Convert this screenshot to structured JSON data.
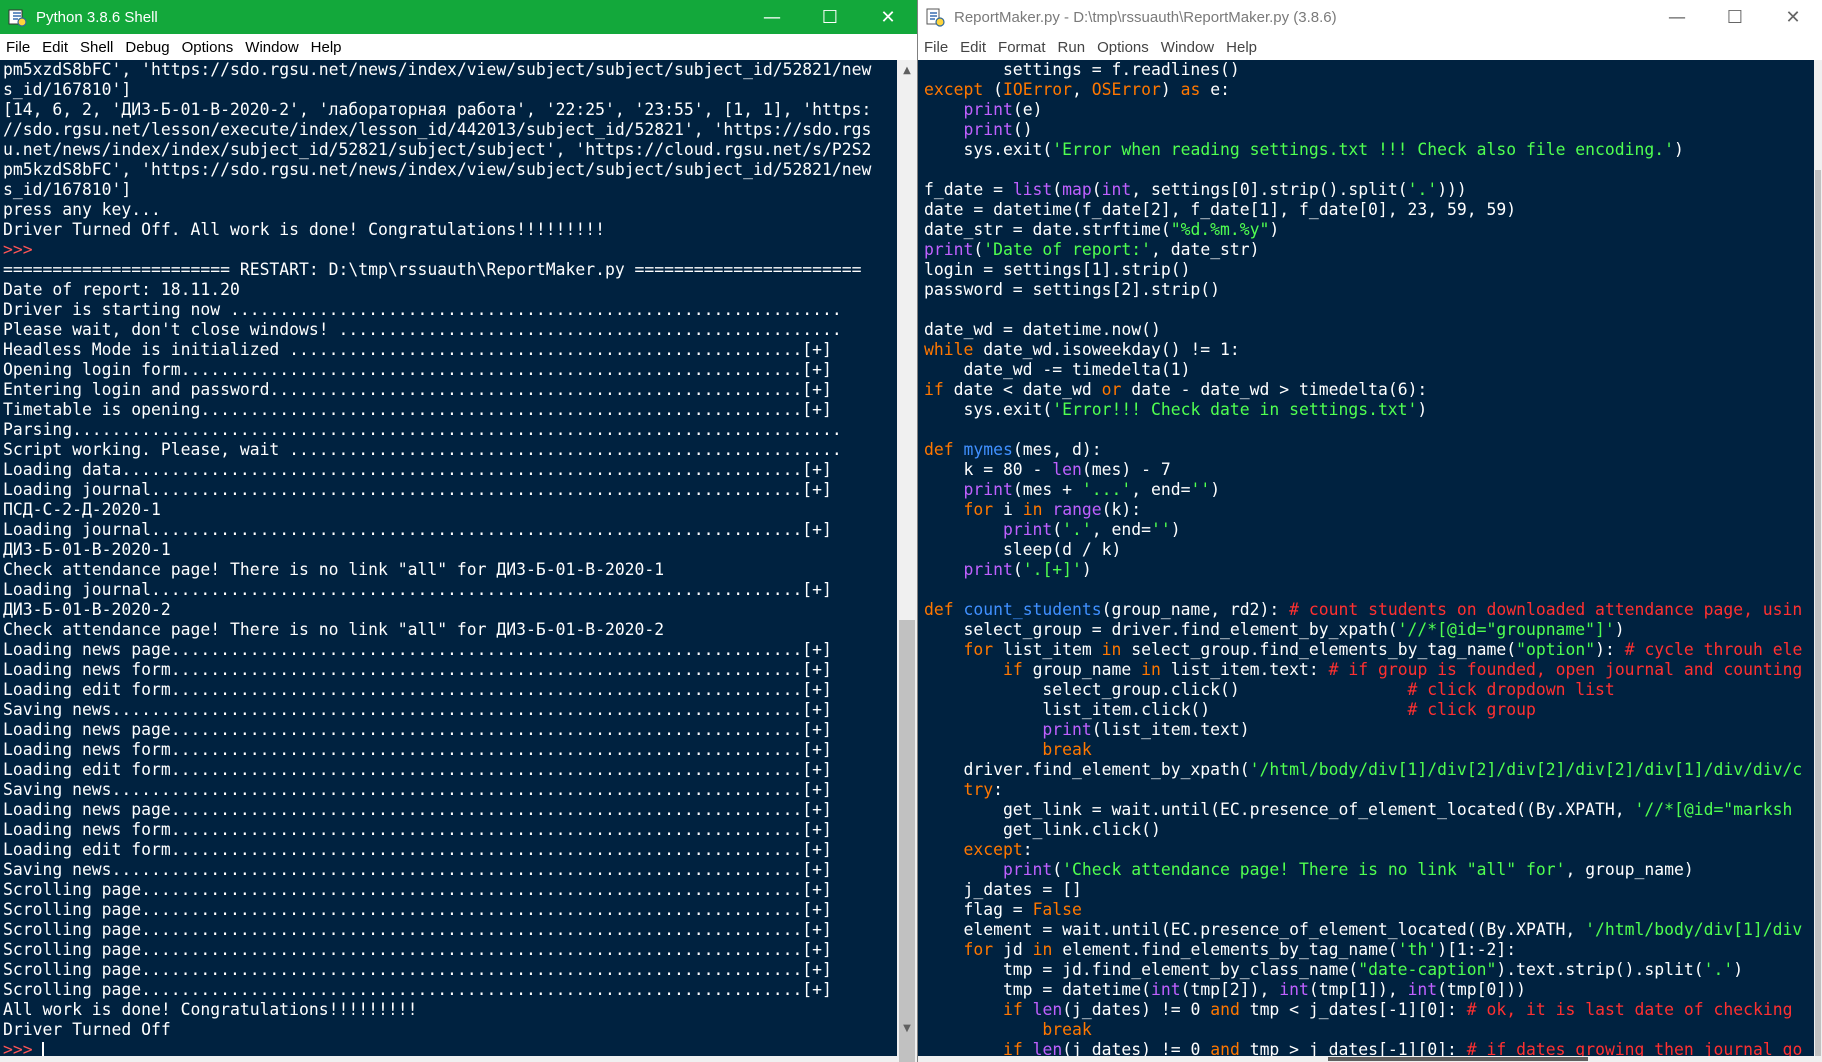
{
  "shell": {
    "title": "Python 3.8.6 Shell",
    "menu": [
      "File",
      "Edit",
      "Shell",
      "Debug",
      "Options",
      "Window",
      "Help"
    ],
    "lines": [
      "pm5xzdS8bFC', 'https://sdo.rgsu.net/news/index/view/subject/subject/subject_id/52821/new",
      "s_id/167810']",
      "[14, 6, 2, 'ДИЗ-Б-01-В-2020-2', 'лабораторная работа', '22:25', '23:55', [1, 1], 'https:",
      "//sdo.rgsu.net/lesson/execute/index/lesson_id/442013/subject_id/52821', 'https://sdo.rgs",
      "u.net/news/index/index/subject_id/52821/subject/subject', 'https://cloud.rgsu.net/s/P2S2",
      "pm5kzdS8bFC', 'https://sdo.rgsu.net/news/index/view/subject/subject/subject_id/52821/new",
      "s_id/167810']",
      "press any key...",
      "Driver Turned Off. All work is done! Congratulations!!!!!!!!!",
      ">>> ",
      "======================= RESTART: D:\\tmp\\rssuauth\\ReportMaker.py =======================",
      "Date of report: 18.11.20",
      "Driver is starting now ..............................................................",
      "Please wait, don't close windows! ...................................................",
      "Headless Mode is initialized ....................................................[+]",
      "Opening login form...............................................................[+]",
      "Entering login and password......................................................[+]",
      "Timetable is opening.............................................................[+]",
      "Parsing..............................................................................",
      "Script working. Please, wait ........................................................",
      "Loading data.....................................................................[+]",
      "Loading journal..................................................................[+]",
      "ПСД-С-2-Д-2020-1",
      "Loading journal..................................................................[+]",
      "ДИЗ-Б-01-В-2020-1",
      "Check attendance page! There is no link \"all\" for ДИЗ-Б-01-В-2020-1",
      "Loading journal..................................................................[+]",
      "ДИЗ-Б-01-В-2020-2",
      "Check attendance page! There is no link \"all\" for ДИЗ-Б-01-В-2020-2",
      "Loading news page................................................................[+]",
      "Loading news form................................................................[+]",
      "Loading edit form................................................................[+]",
      "Saving news......................................................................[+]",
      "Loading news page................................................................[+]",
      "Loading news form................................................................[+]",
      "Loading edit form................................................................[+]",
      "Saving news......................................................................[+]",
      "Loading news page................................................................[+]",
      "Loading news form................................................................[+]",
      "Loading edit form................................................................[+]",
      "Saving news......................................................................[+]",
      "Scrolling page...................................................................[+]",
      "Scrolling page...................................................................[+]",
      "Scrolling page...................................................................[+]",
      "Scrolling page...................................................................[+]",
      "Scrolling page...................................................................[+]",
      "Scrolling page...................................................................[+]",
      "All work is done! Congratulations!!!!!!!!!",
      "Driver Turned Off"
    ],
    "prompt": ">>> "
  },
  "editor": {
    "title": "ReportMaker.py - D:\\tmp\\rssuauth\\ReportMaker.py (3.8.6)",
    "menu": [
      "File",
      "Edit",
      "Format",
      "Run",
      "Options",
      "Window",
      "Help"
    ],
    "code": [
      [
        [
          "",
          "        settings = f.readlines()"
        ]
      ],
      [
        [
          "kw",
          "except"
        ],
        [
          "",
          " ("
        ],
        [
          "ex",
          "IOError"
        ],
        [
          "",
          ", "
        ],
        [
          "ex",
          "OSError"
        ],
        [
          "",
          ") "
        ],
        [
          "kw",
          "as"
        ],
        [
          "",
          " e:"
        ]
      ],
      [
        [
          "",
          "    "
        ],
        [
          "bi",
          "print"
        ],
        [
          "",
          "(e)"
        ]
      ],
      [
        [
          "",
          "    "
        ],
        [
          "bi",
          "print"
        ],
        [
          "",
          "()"
        ]
      ],
      [
        [
          "",
          "    sys.exit("
        ],
        [
          "st",
          "'Error when reading settings.txt !!! Check also file encoding.'"
        ],
        [
          "",
          ")"
        ]
      ],
      [
        [
          "",
          ""
        ]
      ],
      [
        [
          "",
          "f_date = "
        ],
        [
          "bi",
          "list"
        ],
        [
          "",
          "("
        ],
        [
          "bi",
          "map"
        ],
        [
          "",
          "("
        ],
        [
          "bi",
          "int"
        ],
        [
          "",
          ", settings[0].strip().split("
        ],
        [
          "st",
          "'.'"
        ],
        [
          "",
          ")))"
        ]
      ],
      [
        [
          "",
          "date = datetime(f_date[2], f_date[1], f_date[0], 23, 59, 59)"
        ]
      ],
      [
        [
          "",
          "date_str = date.strftime("
        ],
        [
          "st",
          "\"%d.%m.%y\""
        ],
        [
          "",
          ")"
        ]
      ],
      [
        [
          "bi",
          "print"
        ],
        [
          "",
          "("
        ],
        [
          "st",
          "'Date of report:'"
        ],
        [
          "",
          ", date_str)"
        ]
      ],
      [
        [
          "",
          "login = settings[1].strip()"
        ]
      ],
      [
        [
          "",
          "password = settings[2].strip()"
        ]
      ],
      [
        [
          "",
          ""
        ]
      ],
      [
        [
          "",
          "date_wd = datetime.now()"
        ]
      ],
      [
        [
          "kw",
          "while"
        ],
        [
          "",
          " date_wd.isoweekday() != 1:"
        ]
      ],
      [
        [
          "",
          "    date_wd -= timedelta(1)"
        ]
      ],
      [
        [
          "kw",
          "if"
        ],
        [
          "",
          " date < date_wd "
        ],
        [
          "kw",
          "or"
        ],
        [
          "",
          " date - date_wd > timedelta(6):"
        ]
      ],
      [
        [
          "",
          "    sys.exit("
        ],
        [
          "st",
          "'Error!!! Check date in settings.txt'"
        ],
        [
          "",
          ")"
        ]
      ],
      [
        [
          "",
          ""
        ]
      ],
      [
        [
          "kw",
          "def"
        ],
        [
          "",
          " "
        ],
        [
          "df",
          "mymes"
        ],
        [
          "",
          "(mes, d):"
        ]
      ],
      [
        [
          "",
          "    k = 80 - "
        ],
        [
          "bi",
          "len"
        ],
        [
          "",
          "(mes) - 7"
        ]
      ],
      [
        [
          "",
          "    "
        ],
        [
          "bi",
          "print"
        ],
        [
          "",
          "(mes + "
        ],
        [
          "st",
          "'...'"
        ],
        [
          "",
          ", end="
        ],
        [
          "st",
          "''"
        ],
        [
          "",
          ")"
        ]
      ],
      [
        [
          "",
          "    "
        ],
        [
          "kw",
          "for"
        ],
        [
          "",
          " i "
        ],
        [
          "kw",
          "in"
        ],
        [
          "",
          " "
        ],
        [
          "bi",
          "range"
        ],
        [
          "",
          "(k):"
        ]
      ],
      [
        [
          "",
          "        "
        ],
        [
          "bi",
          "print"
        ],
        [
          "",
          "("
        ],
        [
          "st",
          "'.'"
        ],
        [
          "",
          ", end="
        ],
        [
          "st",
          "''"
        ],
        [
          "",
          ")"
        ]
      ],
      [
        [
          "",
          "        sleep(d / k)"
        ]
      ],
      [
        [
          "",
          "    "
        ],
        [
          "bi",
          "print"
        ],
        [
          "",
          "("
        ],
        [
          "st",
          "'.[+]'"
        ],
        [
          "",
          ")"
        ]
      ],
      [
        [
          "",
          ""
        ]
      ],
      [
        [
          "kw",
          "def"
        ],
        [
          "",
          " "
        ],
        [
          "df",
          "count_students"
        ],
        [
          "",
          "(group_name, rd2): "
        ],
        [
          "cm",
          "# count students on downloaded attendance page, usin"
        ]
      ],
      [
        [
          "",
          "    select_group = driver.find_element_by_xpath("
        ],
        [
          "st",
          "'//*[@id=\"groupname\"]'"
        ],
        [
          "",
          ")"
        ]
      ],
      [
        [
          "",
          "    "
        ],
        [
          "kw",
          "for"
        ],
        [
          "",
          " list_item "
        ],
        [
          "kw",
          "in"
        ],
        [
          "",
          " select_group.find_elements_by_tag_name("
        ],
        [
          "st",
          "\"option\""
        ],
        [
          "",
          "): "
        ],
        [
          "cm",
          "# cycle throuh ele"
        ]
      ],
      [
        [
          "",
          "        "
        ],
        [
          "kw",
          "if"
        ],
        [
          "",
          " group_name "
        ],
        [
          "kw",
          "in"
        ],
        [
          "",
          " list_item.text: "
        ],
        [
          "cm",
          "# if group is founded, open journal and counting"
        ]
      ],
      [
        [
          "",
          "            select_group.click()                 "
        ],
        [
          "cm",
          "# click dropdown list"
        ]
      ],
      [
        [
          "",
          "            list_item.click()                    "
        ],
        [
          "cm",
          "# click group"
        ]
      ],
      [
        [
          "",
          "            "
        ],
        [
          "bi",
          "print"
        ],
        [
          "",
          "(list_item.text)"
        ]
      ],
      [
        [
          "",
          "            "
        ],
        [
          "kw",
          "break"
        ]
      ],
      [
        [
          "",
          "    driver.find_element_by_xpath("
        ],
        [
          "st",
          "'/html/body/div[1]/div[2]/div[2]/div[2]/div[1]/div/div/c"
        ]
      ],
      [
        [
          "",
          "    "
        ],
        [
          "kw",
          "try"
        ],
        [
          "",
          ":"
        ]
      ],
      [
        [
          "",
          "        get_link = wait.until(EC.presence_of_element_located((By.XPATH, "
        ],
        [
          "st",
          "'//*[@id=\"marksh"
        ]
      ],
      [
        [
          "",
          "        get_link.click()"
        ]
      ],
      [
        [
          "",
          "    "
        ],
        [
          "kw",
          "except"
        ],
        [
          "",
          ":"
        ]
      ],
      [
        [
          "",
          "        "
        ],
        [
          "bi",
          "print"
        ],
        [
          "",
          "("
        ],
        [
          "st",
          "'Check attendance page! There is no link \"all\" for'"
        ],
        [
          "",
          ", group_name)"
        ]
      ],
      [
        [
          "",
          "    j_dates = []"
        ]
      ],
      [
        [
          "",
          "    flag = "
        ],
        [
          "kw",
          "False"
        ]
      ],
      [
        [
          "",
          "    element = wait.until(EC.presence_of_element_located((By.XPATH, "
        ],
        [
          "st",
          "'/html/body/div[1]/div"
        ]
      ],
      [
        [
          "",
          "    "
        ],
        [
          "kw",
          "for"
        ],
        [
          "",
          " jd "
        ],
        [
          "kw",
          "in"
        ],
        [
          "",
          " element.find_elements_by_tag_name("
        ],
        [
          "st",
          "'th'"
        ],
        [
          "",
          ")[1:-2]:"
        ]
      ],
      [
        [
          "",
          "        tmp = jd.find_element_by_class_name("
        ],
        [
          "st",
          "\"date-caption\""
        ],
        [
          "",
          ").text.strip().split("
        ],
        [
          "st",
          "'.'"
        ],
        [
          "",
          ")"
        ]
      ],
      [
        [
          "",
          "        tmp = datetime("
        ],
        [
          "bi",
          "int"
        ],
        [
          "",
          "(tmp[2]), "
        ],
        [
          "bi",
          "int"
        ],
        [
          "",
          "(tmp[1]), "
        ],
        [
          "bi",
          "int"
        ],
        [
          "",
          "(tmp[0]))"
        ]
      ],
      [
        [
          "",
          "        "
        ],
        [
          "kw",
          "if"
        ],
        [
          "",
          " "
        ],
        [
          "bi",
          "len"
        ],
        [
          "",
          "(j_dates) != 0 "
        ],
        [
          "kw",
          "and"
        ],
        [
          "",
          " tmp < j_dates[-1][0]: "
        ],
        [
          "cm",
          "# ok, it is last date of checking"
        ]
      ],
      [
        [
          "",
          "            "
        ],
        [
          "kw",
          "break"
        ]
      ],
      [
        [
          "",
          "        "
        ],
        [
          "kw",
          "if"
        ],
        [
          "",
          " "
        ],
        [
          "bi",
          "len"
        ],
        [
          "",
          "(j_dates) != 0 "
        ],
        [
          "kw",
          "and"
        ],
        [
          "",
          " tmp > j_dates[-1][0]: "
        ],
        [
          "cm",
          "# if dates growing then journal go"
        ]
      ]
    ]
  }
}
